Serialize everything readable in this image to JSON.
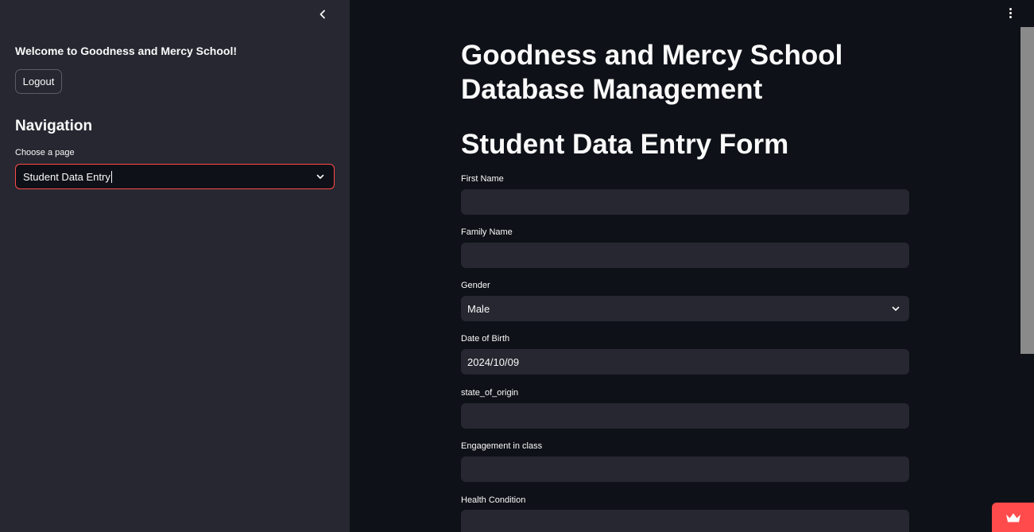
{
  "sidebar": {
    "welcome": "Welcome to Goodness and Mercy School!",
    "logout_label": "Logout",
    "nav_heading": "Navigation",
    "page_select_label": "Choose a page",
    "page_select_value": "Student Data Entry"
  },
  "main": {
    "title": "Goodness and Mercy School Database Management",
    "form_title": "Student Data Entry Form",
    "fields": [
      {
        "label": "First Name",
        "value": ""
      },
      {
        "label": "Family Name",
        "value": ""
      },
      {
        "label": "Gender",
        "value": "Male"
      },
      {
        "label": "Date of Birth",
        "value": "2024/10/09"
      },
      {
        "label": "state_of_origin",
        "value": ""
      },
      {
        "label": "Engagement in class",
        "value": ""
      },
      {
        "label": "Health Condition",
        "value": ""
      }
    ]
  },
  "colors": {
    "accent": "#ff4b4b",
    "sidebar_bg": "#262730",
    "main_bg": "#0e1117",
    "input_bg": "#262730"
  },
  "icons": {
    "collapse": "chevron-left-icon",
    "select": "chevron-down-icon",
    "menu": "vertical-dots-icon",
    "badge": "crown-icon"
  }
}
